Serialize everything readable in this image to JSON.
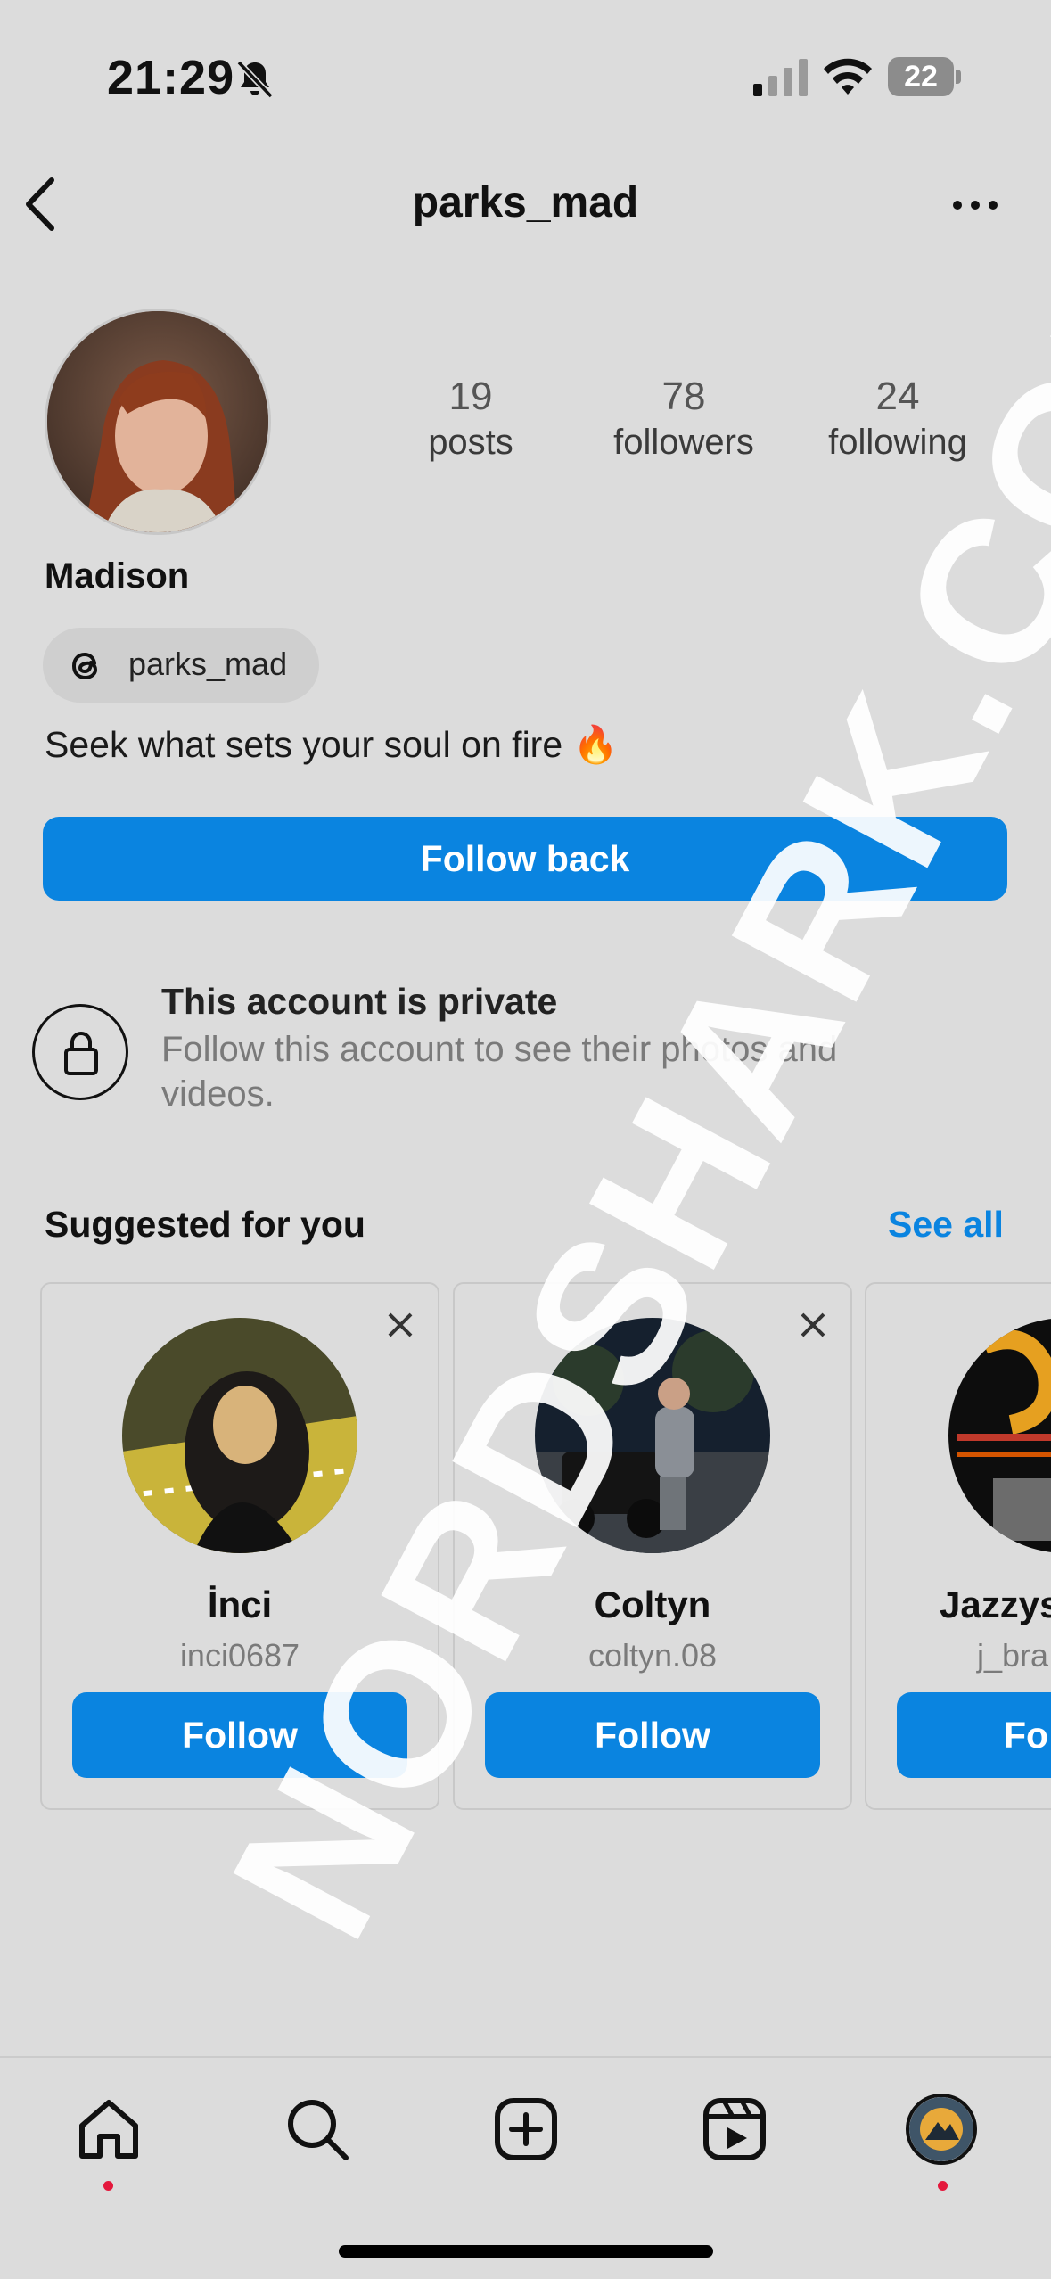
{
  "status_bar": {
    "time": "21:29",
    "battery": "22",
    "icons": [
      "bell-slash-icon",
      "cell-signal-icon",
      "wifi-icon",
      "battery-icon"
    ]
  },
  "header": {
    "username": "parks_mad",
    "back_icon": "chevron-left-icon",
    "more_icon": "ellipsis-icon"
  },
  "profile": {
    "display_name": "Madison",
    "stats": [
      {
        "value": "19",
        "label": "posts"
      },
      {
        "value": "78",
        "label": "followers"
      },
      {
        "value": "24",
        "label": "following"
      }
    ],
    "threads_handle": "parks_mad",
    "bio": "Seek what sets your soul on fire 🔥",
    "follow_back_label": "Follow back"
  },
  "private_notice": {
    "title": "This account is private",
    "body": "Follow this account to see their photos and videos."
  },
  "suggested": {
    "title": "Suggested for you",
    "see_all": "See all",
    "cards": [
      {
        "name": "İnci",
        "username": "inci0687",
        "button": "Follow"
      },
      {
        "name": "Coltyn",
        "username": "coltyn.08",
        "button": "Follow"
      },
      {
        "name": "Jazzys",
        "username": "j_bra",
        "button": "Fo"
      }
    ]
  },
  "watermark": "NORDSHARK.COM",
  "tab_bar": [
    "home-icon",
    "search-icon",
    "create-icon",
    "reels-icon",
    "profile-avatar"
  ],
  "colors": {
    "accent": "#0a84e0",
    "background": "#dcdcdc",
    "notification_dot": "#e4183c"
  }
}
